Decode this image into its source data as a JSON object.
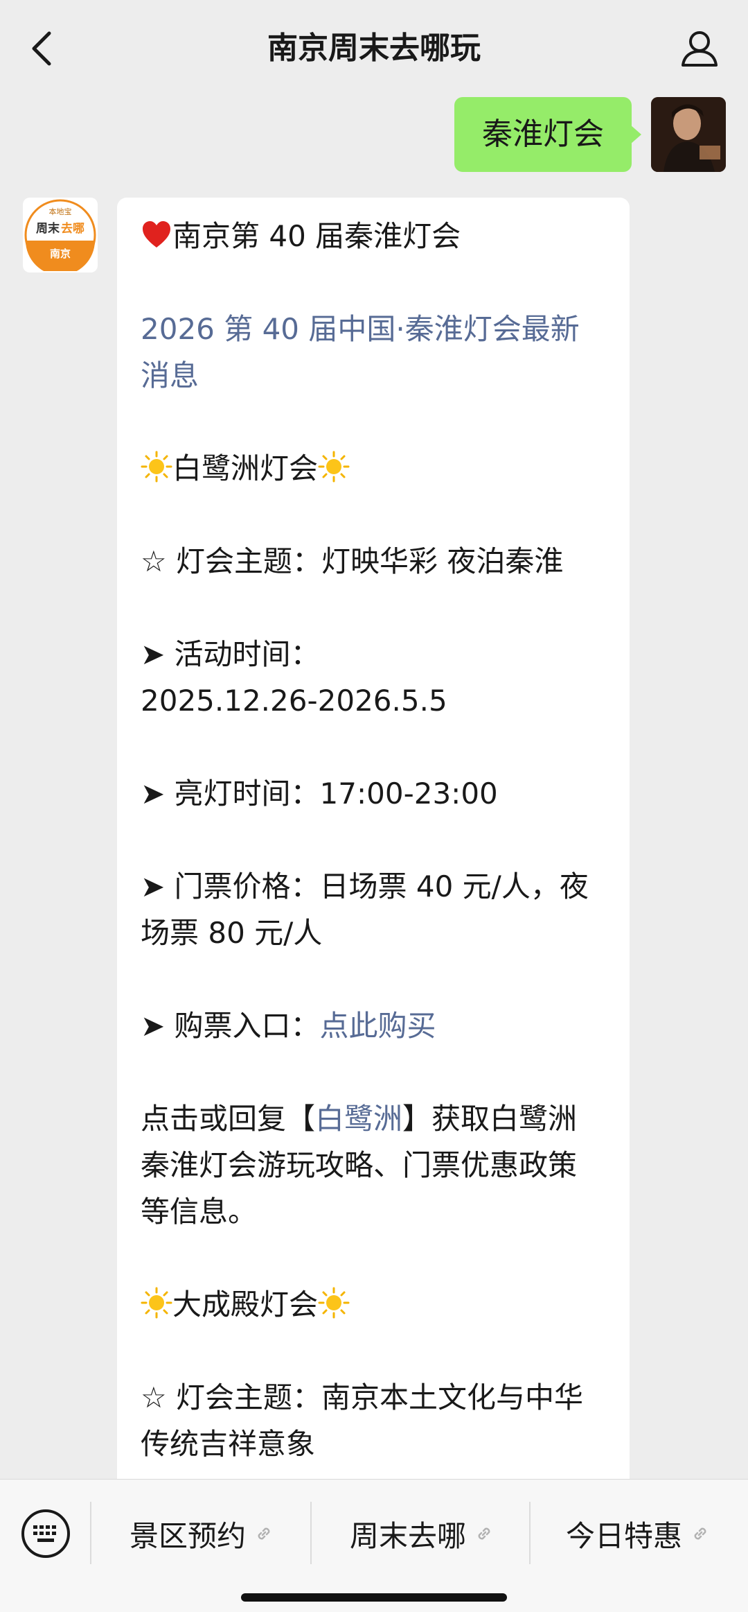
{
  "header": {
    "title": "南京周末去哪玩",
    "back_icon": "chevron-left-icon",
    "profile_icon": "user-icon"
  },
  "chat": {
    "outgoing_message": "秦淮灯会",
    "bot_avatar": {
      "badge": "本地宝",
      "brand_a": "周末",
      "brand_b": "去哪",
      "city": "南京"
    },
    "incoming": {
      "title_emoji": "heart-icon",
      "title": "南京第 40 届秦淮灯会",
      "news_link_1": "2026 第 40 届中国·秦淮灯会最新",
      "news_link_2": "消息",
      "section1_title": "白鹭洲灯会",
      "theme1_line": "☆ 灯会主题：灯映华彩 夜泊秦淮",
      "activity_label": "➤ 活动时间：",
      "activity_value": "2025.12.26-2026.5.5",
      "lighting_line": "➤ 亮灯时间：17:00-23:00",
      "ticket_line_1": "➤ 门票价格：日场票 40 元/人，夜",
      "ticket_line_2": "场票 80 元/人",
      "purchase_label": "➤ 购票入口：",
      "purchase_link": "点此购买",
      "reply_prefix": "点击或回复【",
      "reply_keyword": "白鹭洲",
      "reply_suffix": "】获取白鹭洲",
      "reply_line_2": "秦淮灯会游玩攻略、门票优惠政策",
      "reply_line_3": "等信息。",
      "section2_title": "大成殿灯会",
      "theme2_line_1": "☆ 灯会主题：南京本土文化与中华",
      "theme2_line_2": "传统吉祥意象"
    }
  },
  "bottom_menu": {
    "keyboard_icon": "keyboard-icon",
    "items": [
      {
        "label": "景区预约",
        "icon": "link-icon"
      },
      {
        "label": "周末去哪",
        "icon": "link-icon"
      },
      {
        "label": "今日特惠",
        "icon": "link-icon"
      }
    ]
  },
  "colors": {
    "background": "#ededed",
    "outgoing_bubble": "#95ec69",
    "link": "#576b95",
    "brand_orange": "#f08c1e"
  }
}
